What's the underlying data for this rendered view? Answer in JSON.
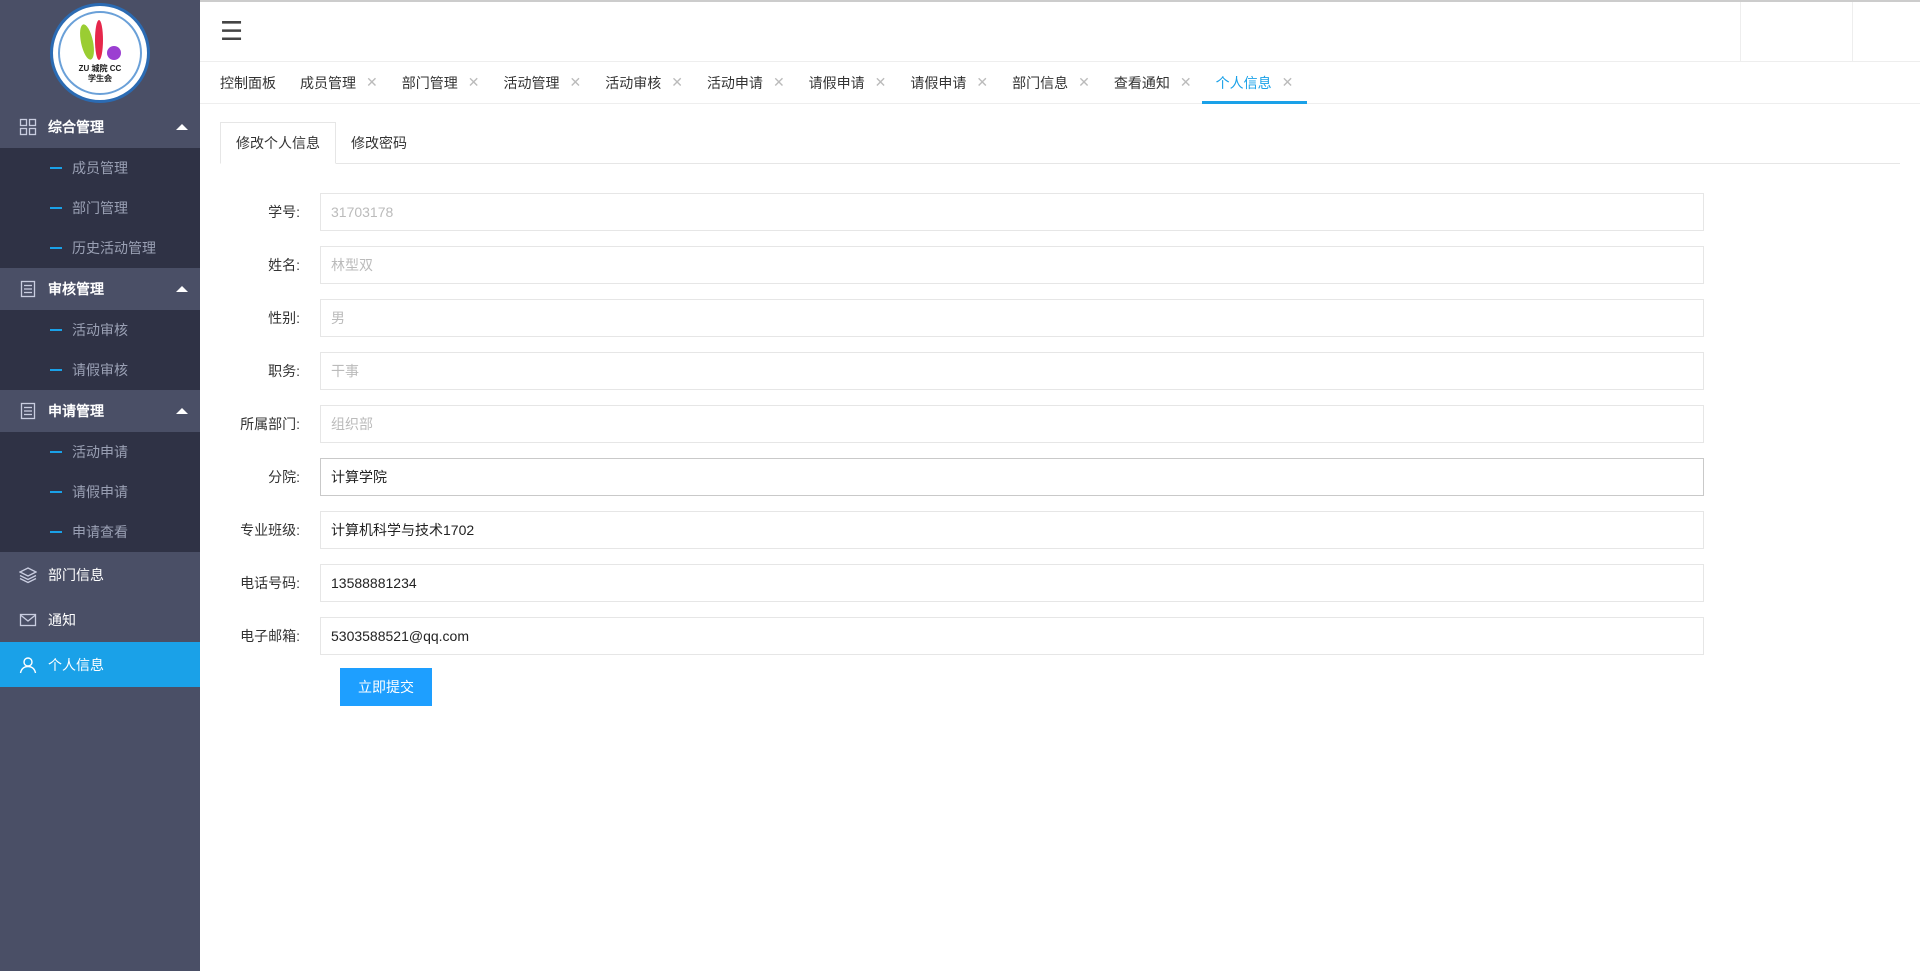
{
  "logo": {
    "top_text": "ZUCC",
    "mid_left": "ZU",
    "mid_center": "城院",
    "mid_right": "CC",
    "bottom_text": "学生会"
  },
  "sidebar": {
    "groups": [
      {
        "label": "综合管理",
        "icon": "grid-icon",
        "items": [
          "成员管理",
          "部门管理",
          "历史活动管理"
        ]
      },
      {
        "label": "审核管理",
        "icon": "document-icon",
        "items": [
          "活动审核",
          "请假审核"
        ]
      },
      {
        "label": "申请管理",
        "icon": "document-icon",
        "items": [
          "活动申请",
          "请假申请",
          "申请查看"
        ]
      }
    ],
    "singles": [
      {
        "label": "部门信息",
        "icon": "layers-icon"
      },
      {
        "label": "通知",
        "icon": "mail-icon"
      },
      {
        "label": "个人信息",
        "icon": "user-icon",
        "active": true
      }
    ]
  },
  "topbar": {
    "menu_glyph": "☰"
  },
  "tabs": [
    {
      "label": "控制面板",
      "closable": false
    },
    {
      "label": "成员管理",
      "closable": true
    },
    {
      "label": "部门管理",
      "closable": true
    },
    {
      "label": "活动管理",
      "closable": true
    },
    {
      "label": "活动审核",
      "closable": true
    },
    {
      "label": "活动申请",
      "closable": true
    },
    {
      "label": "请假申请",
      "closable": true
    },
    {
      "label": "请假申请",
      "closable": true
    },
    {
      "label": "部门信息",
      "closable": true
    },
    {
      "label": "查看通知",
      "closable": true
    },
    {
      "label": "个人信息",
      "closable": true,
      "active": true
    }
  ],
  "tab_close_glyph": "✕",
  "form_tabs": [
    {
      "label": "修改个人信息",
      "active": true
    },
    {
      "label": "修改密码",
      "active": false
    }
  ],
  "form": {
    "fields": [
      {
        "label": "学号:",
        "value": "31703178",
        "disabled": true
      },
      {
        "label": "姓名:",
        "value": "林型双",
        "disabled": true
      },
      {
        "label": "性别:",
        "value": "男",
        "disabled": true
      },
      {
        "label": "职务:",
        "value": "干事",
        "disabled": true
      },
      {
        "label": "所属部门:",
        "value": "组织部",
        "disabled": true
      },
      {
        "label": "分院:",
        "value": "计算学院",
        "disabled": false,
        "focused": true
      },
      {
        "label": "专业班级:",
        "value": "计算机科学与技术1702",
        "disabled": false
      },
      {
        "label": "电话号码:",
        "value": "13588881234",
        "disabled": false
      },
      {
        "label": "电子邮箱:",
        "value": "5303588521@qq.com",
        "disabled": false
      }
    ],
    "submit_label": "立即提交"
  },
  "colors": {
    "sidebar_bg": "#4a4f66",
    "sidebar_sub_bg": "#2f3245",
    "accent": "#1aa1e8",
    "button": "#1e9fff"
  }
}
